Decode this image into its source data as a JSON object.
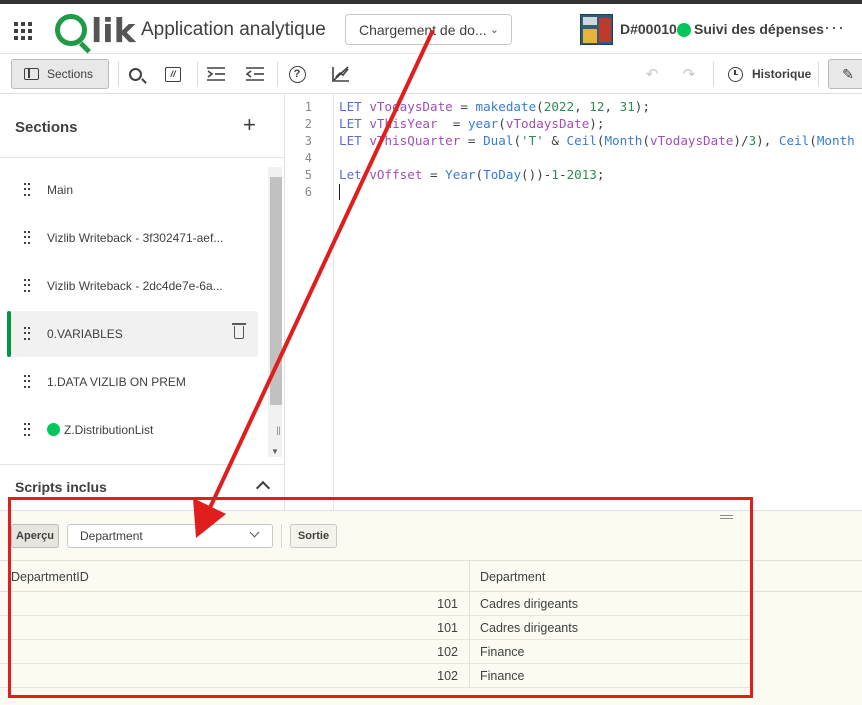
{
  "header": {
    "app_title": "Application analytique",
    "logo_text": "lik",
    "mode": "Chargement de do...",
    "space_id": "D#00010",
    "space_name": "Suivi des dépenses",
    "more_label": "···"
  },
  "toolbar": {
    "sections_label": "Sections",
    "comment_glyph": "//",
    "help_glyph": "?",
    "history_label": "Historique"
  },
  "sidebar": {
    "title": "Sections",
    "add_glyph": "+",
    "items": [
      {
        "label": "Main",
        "active": false
      },
      {
        "label": "Vizlib Writeback - 3f302471-aef...",
        "active": false
      },
      {
        "label": "Vizlib Writeback - 2dc4de7e-6a...",
        "active": false
      },
      {
        "label": "0.VARIABLES",
        "active": true
      },
      {
        "label": "1.DATA VIZLIB ON PREM",
        "active": false
      },
      {
        "label": "Z.DistributionList",
        "active": false,
        "status_dot": "#00c65e"
      }
    ],
    "footer_title": "Scripts inclus"
  },
  "editor": {
    "line_numbers": [
      "1",
      "2",
      "3",
      "4",
      "5",
      "6"
    ],
    "lines": [
      "LET vTodaysDate = makedate(2022, 12, 31);",
      "LET vThisYear  = year(vTodaysDate);",
      "LET vThisQuarter = Dual('T' & Ceil(Month(vTodaysDate)/3), Ceil(Month",
      "",
      "Let vOffset = Year(ToDay())-1-2013;",
      ""
    ]
  },
  "preview": {
    "preview_label": "Aperçu",
    "selected_table": "Department",
    "output_label": "Sortie",
    "columns": [
      "DepartmentID",
      "Department"
    ],
    "rows": [
      [
        "101",
        "Cadres dirigeants"
      ],
      [
        "101",
        "Cadres dirigeants"
      ],
      [
        "102",
        "Finance"
      ],
      [
        "102",
        "Finance"
      ]
    ]
  },
  "colors": {
    "accent_green": "#009845",
    "status_green": "#00c65e",
    "annotation_red": "#e01e1e"
  }
}
